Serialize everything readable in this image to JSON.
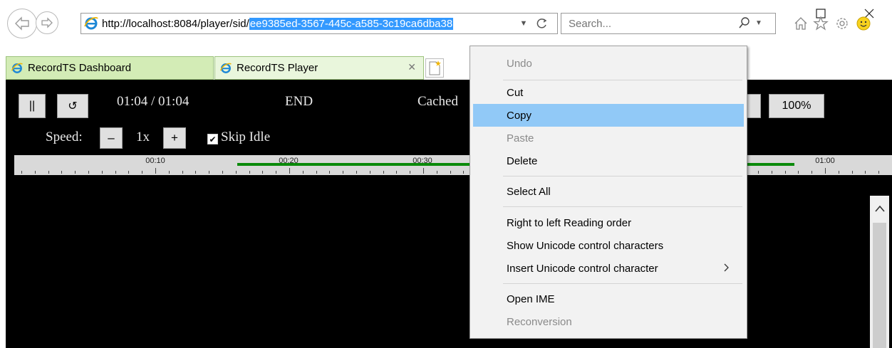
{
  "window": {
    "minimize_icon": "minimize-icon",
    "maximize_icon": "maximize-icon",
    "close_icon": "close-icon"
  },
  "address_bar": {
    "url_prefix": "http://localhost:8084/player/sid/",
    "url_selected": "ee9385ed-3567-445c-a585-3c19ca6dba38",
    "selection_color": "#3399ff"
  },
  "search": {
    "placeholder": "Search..."
  },
  "tabs": [
    {
      "label": "RecordTS Dashboard",
      "active": false,
      "color": "#d3ecb6"
    },
    {
      "label": "RecordTS Player",
      "active": true,
      "color": "#e9f6dc"
    }
  ],
  "toolbar_icons": [
    "home-icon",
    "favorites-star-icon",
    "settings-gear-icon",
    "smiley-feedback-icon"
  ],
  "player": {
    "pause_label": "||",
    "restart_label": "↺",
    "time": "01:04 / 01:04",
    "status": "END",
    "cached_text": "Cached",
    "zoom_label": "100%",
    "speed_label": "Speed:",
    "speed_minus": "–",
    "speed_value": "1x",
    "speed_plus": "+",
    "skip_idle_label": "Skip Idle",
    "skip_idle_checked": true,
    "stray_char": ":",
    "timeline": {
      "tick_labels": [
        "00:10",
        "00:20",
        "00:30",
        "01:00"
      ],
      "cached_color": "#0a8a0a"
    }
  },
  "context_menu": {
    "items": [
      {
        "label": "Undo",
        "disabled": true
      },
      {
        "label": "Cut",
        "disabled": false
      },
      {
        "label": "Copy",
        "disabled": false,
        "highlighted": true
      },
      {
        "label": "Paste",
        "disabled": true
      },
      {
        "label": "Delete",
        "disabled": false
      },
      {
        "label": "Select All",
        "disabled": false
      },
      {
        "label": "Right to left Reading order",
        "disabled": false
      },
      {
        "label": "Show Unicode control characters",
        "disabled": false
      },
      {
        "label": "Insert Unicode control character",
        "disabled": false,
        "submenu": true
      },
      {
        "label": "Open IME",
        "disabled": false
      },
      {
        "label": "Reconversion",
        "disabled": true
      }
    ],
    "highlight_color": "#91c9f7"
  }
}
